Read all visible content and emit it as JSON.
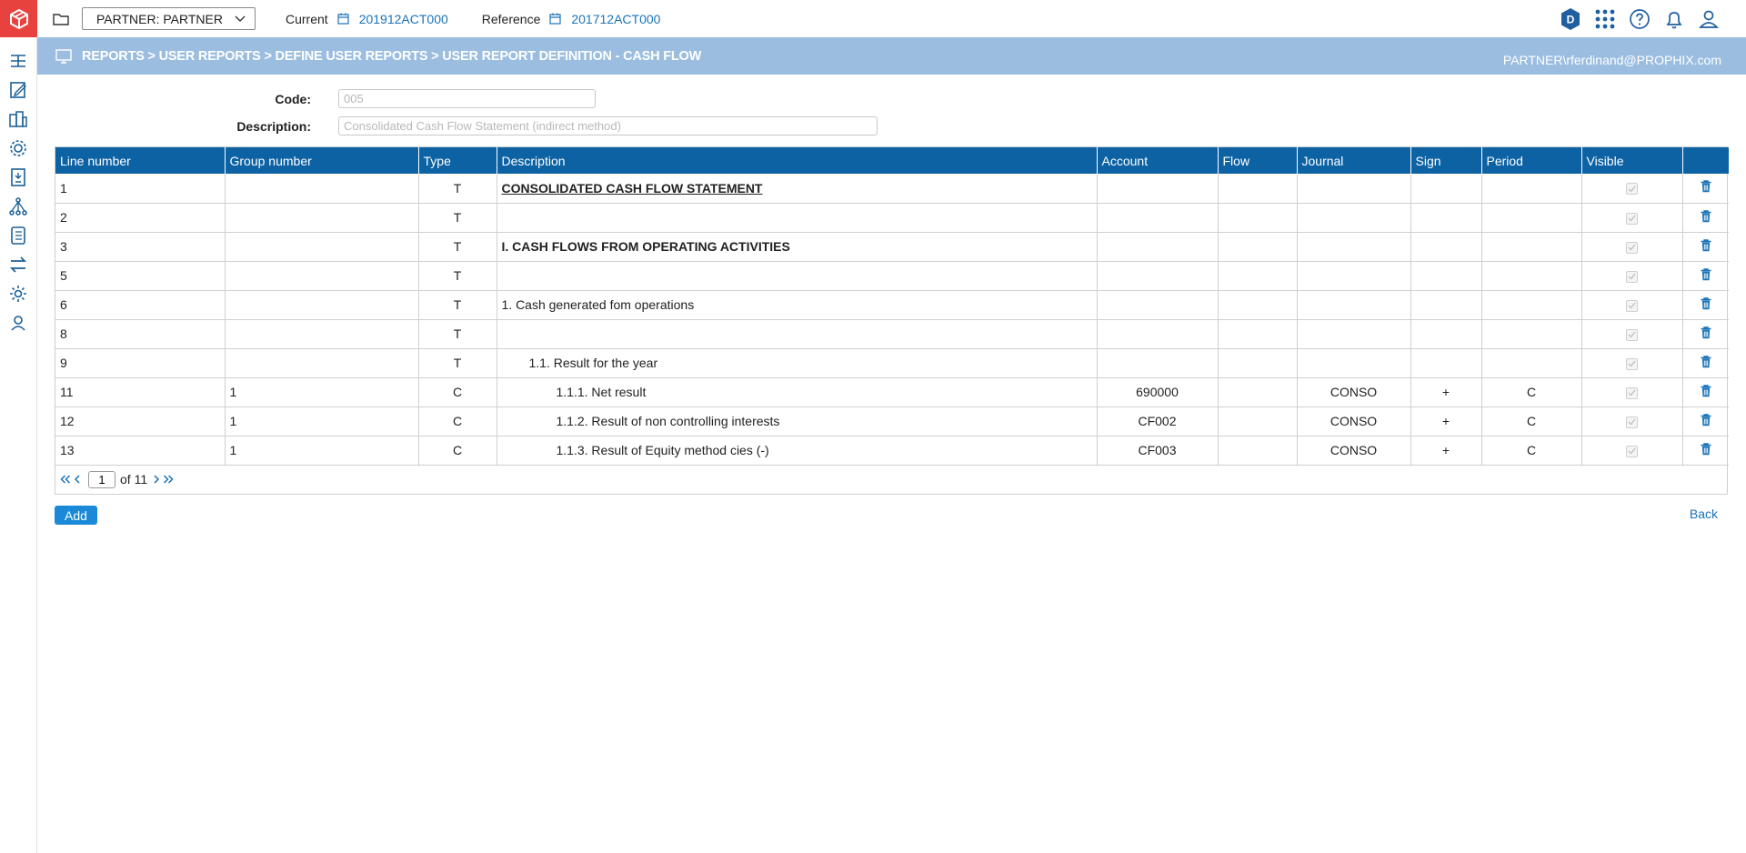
{
  "topbar": {
    "partner_select": "PARTNER: PARTNER",
    "current_label": "Current",
    "current_value": "201912ACT000",
    "reference_label": "Reference",
    "reference_value": "201712ACT000",
    "badge_letter": "D"
  },
  "breadcrumb": {
    "path": "REPORTS > USER REPORTS > DEFINE USER REPORTS > USER REPORT DEFINITION - CASH FLOW",
    "user": "PARTNER\\rferdinand@PROPHIX.com"
  },
  "form": {
    "code_label": "Code:",
    "code_value": "005",
    "description_label": "Description:",
    "description_value": "Consolidated Cash Flow Statement (indirect method)"
  },
  "table": {
    "headers": {
      "line_number": "Line number",
      "group_number": "Group number",
      "type": "Type",
      "description": "Description",
      "account": "Account",
      "flow": "Flow",
      "journal": "Journal",
      "sign": "Sign",
      "period": "Period",
      "visible": "Visible"
    },
    "rows": [
      {
        "line": "1",
        "group": "",
        "type": "T",
        "desc": "CONSOLIDATED CASH FLOW STATEMENT",
        "account": "",
        "flow": "",
        "journal": "",
        "sign": "",
        "period": ""
      },
      {
        "line": "2",
        "group": "",
        "type": "T",
        "desc": "",
        "account": "",
        "flow": "",
        "journal": "",
        "sign": "",
        "period": ""
      },
      {
        "line": "3",
        "group": "",
        "type": "T",
        "desc": "I. CASH FLOWS FROM OPERATING ACTIVITIES",
        "account": "",
        "flow": "",
        "journal": "",
        "sign": "",
        "period": ""
      },
      {
        "line": "5",
        "group": "",
        "type": "T",
        "desc": "",
        "account": "",
        "flow": "",
        "journal": "",
        "sign": "",
        "period": ""
      },
      {
        "line": "6",
        "group": "",
        "type": "T",
        "desc": "1. Cash generated fom operations",
        "account": "",
        "flow": "",
        "journal": "",
        "sign": "",
        "period": ""
      },
      {
        "line": "8",
        "group": "",
        "type": "T",
        "desc": "",
        "account": "",
        "flow": "",
        "journal": "",
        "sign": "",
        "period": ""
      },
      {
        "line": "9",
        "group": "",
        "type": "T",
        "desc": "1.1. Result for the year",
        "account": "",
        "flow": "",
        "journal": "",
        "sign": "",
        "period": ""
      },
      {
        "line": "11",
        "group": "1",
        "type": "C",
        "desc": "1.1.1. Net result",
        "account": "690000",
        "flow": "",
        "journal": "CONSO",
        "sign": "+",
        "period": "C"
      },
      {
        "line": "12",
        "group": "1",
        "type": "C",
        "desc": "1.1.2. Result of non controlling interests",
        "account": "CF002",
        "flow": "",
        "journal": "CONSO",
        "sign": "+",
        "period": "C"
      },
      {
        "line": "13",
        "group": "1",
        "type": "C",
        "desc": "1.1.3. Result of Equity method cies (-)",
        "account": "CF003",
        "flow": "",
        "journal": "CONSO",
        "sign": "+",
        "period": "C"
      }
    ]
  },
  "pager": {
    "current_page": "1",
    "of_label": "of",
    "total_pages": "11"
  },
  "actions": {
    "add_label": "Add",
    "back_label": "Back"
  },
  "colors": {
    "brand_red": "#e8423f",
    "header_blue": "#0d62a4",
    "breadcrumb_blue": "#9bbde0",
    "link_blue": "#1a73b8"
  }
}
